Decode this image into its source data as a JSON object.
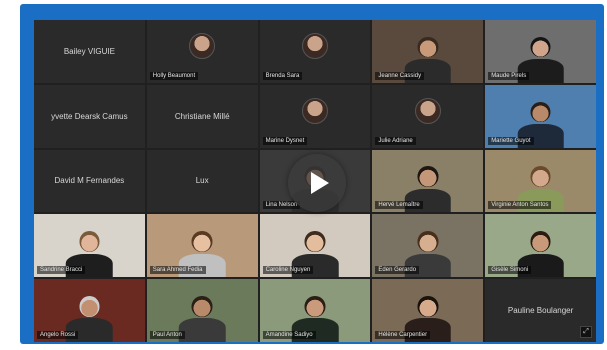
{
  "meeting": {
    "participants": [
      {
        "name": "Bailey VIGUIE",
        "video": false,
        "avatar": false
      },
      {
        "name": "Holly Beaumont",
        "video": false,
        "avatar": true
      },
      {
        "name": "Brenda Sara",
        "video": false,
        "avatar": true
      },
      {
        "name": "Jeanne Cassidy",
        "video": true,
        "bg": "#5a4a3e",
        "skin": "#c99a7a",
        "shirt": "#2b2b2b",
        "hair": "#3a2a1e"
      },
      {
        "name": "Maude Pirels",
        "video": true,
        "bg": "#6e6e6e",
        "skin": "#d0a48a",
        "shirt": "#1c1c1c",
        "hair": "#141414"
      },
      {
        "name": "yvette Dearsk Camus",
        "video": false,
        "avatar": false
      },
      {
        "name": "Christiane Millé",
        "video": false,
        "avatar": false
      },
      {
        "name": "Marine Dysnet",
        "video": false,
        "avatar": true
      },
      {
        "name": "Julie Adriane",
        "video": false,
        "avatar": true
      },
      {
        "name": "Mariette Guyot",
        "video": true,
        "bg": "#4f7fae",
        "skin": "#b88a6a",
        "shirt": "#1e2a3a",
        "hair": "#2a1e16"
      },
      {
        "name": "David M Fernandes",
        "video": false,
        "avatar": false
      },
      {
        "name": "Lux",
        "video": false,
        "avatar": false
      },
      {
        "name": "Lina Nelson",
        "video": true,
        "bg": "#3a3a3a",
        "skin": "#c0937a",
        "shirt": "#2e2e2e",
        "hair": "#2a1c14"
      },
      {
        "name": "Hervé Lemaître",
        "video": true,
        "bg": "#8a8068",
        "skin": "#c39777",
        "shirt": "#2c2c2c",
        "hair": "#1e1610"
      },
      {
        "name": "Virginie Anton Santos",
        "video": true,
        "bg": "#9a8a6a",
        "skin": "#d2a98c",
        "shirt": "#8a9a5a",
        "hair": "#6a4a2a"
      },
      {
        "name": "Sandrine Bracci",
        "video": true,
        "bg": "#d8d4cc",
        "skin": "#e0b59a",
        "shirt": "#1e1e1e",
        "hair": "#7a5a3a"
      },
      {
        "name": "Sara Ahmed Fedia",
        "video": true,
        "bg": "#b89a7a",
        "skin": "#e6c0a0",
        "shirt": "#c0c0c0",
        "hair": "#5a3a22"
      },
      {
        "name": "Caroline Nguyen",
        "video": true,
        "bg": "#d2cabe",
        "skin": "#e3bd9e",
        "shirt": "#2a2a2a",
        "hair": "#3e2c1e"
      },
      {
        "name": "Eden Gerardo",
        "video": true,
        "bg": "#7a7262",
        "skin": "#d6ae90",
        "shirt": "#3a3a3a",
        "hair": "#4a2e1a"
      },
      {
        "name": "Gisèle Simoni",
        "video": true,
        "bg": "#9aa88a",
        "skin": "#c89a7a",
        "shirt": "#1a1a1a",
        "hair": "#2a1a10"
      },
      {
        "name": "Angelo Rossi",
        "video": true,
        "bg": "#6a2a22",
        "skin": "#c29070",
        "shirt": "#2a2a2a",
        "hair": "#cccccc"
      },
      {
        "name": "Paul Anton",
        "video": true,
        "bg": "#6a7a5a",
        "skin": "#b88a6a",
        "shirt": "#3a3a3a",
        "hair": "#2a2016"
      },
      {
        "name": "Amandine Sadiyo",
        "video": true,
        "bg": "#8a9a7a",
        "skin": "#c99a7c",
        "shirt": "#1e2a22",
        "hair": "#2c1e14"
      },
      {
        "name": "Hélène Carpentier",
        "video": true,
        "bg": "#7a6a56",
        "skin": "#d6aa8a",
        "shirt": "#2a1e1a",
        "hair": "#1a120c"
      },
      {
        "name": "Pauline Boulanger",
        "video": false,
        "avatar": false
      }
    ]
  },
  "colors": {
    "frame": "#1a6fc4",
    "screen_bg": "#202020",
    "tile_bg": "#2a2a2a"
  },
  "icons": {
    "play": "play-icon",
    "corner": "expand-icon"
  }
}
